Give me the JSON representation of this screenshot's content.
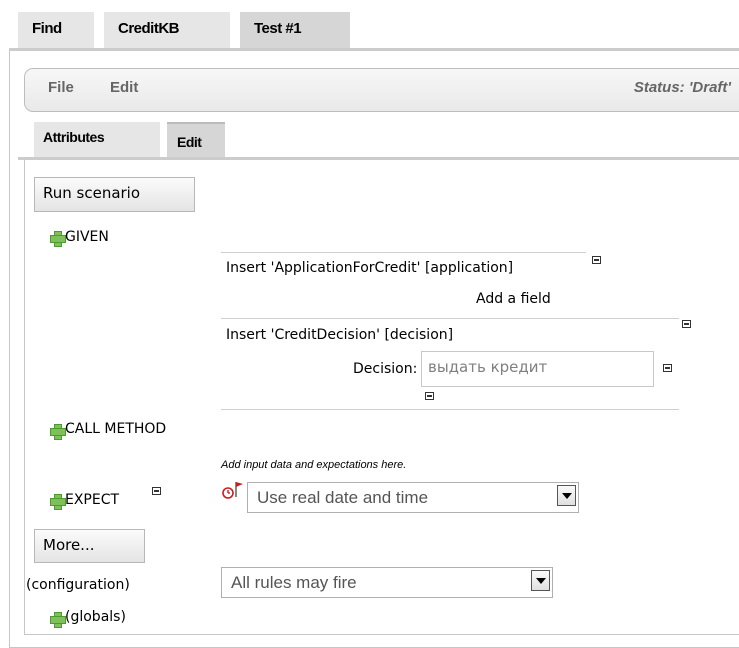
{
  "top_tabs": [
    "Find",
    "CreditKB",
    "Test #1"
  ],
  "menu": {
    "file": "File",
    "edit": "Edit",
    "status": "Status: 'Draft'"
  },
  "inner_tabs": [
    "Attributes",
    "Edit"
  ],
  "run_button": "Run scenario",
  "sections": {
    "given": "GIVEN",
    "call_method": "CALL METHOD",
    "expect": "EXPECT",
    "globals": "(globals)"
  },
  "facts": [
    {
      "label": "Insert 'ApplicationForCredit' [application]",
      "add_field": "Add a field"
    },
    {
      "label": "Insert 'CreditDecision' [decision]",
      "field_label": "Decision:",
      "field_value": "выдать кредит"
    }
  ],
  "hint": "Add input data and expectations here.",
  "date_select": {
    "value": "Use real date and time",
    "icon": "clock-flag-icon"
  },
  "more_button": "More...",
  "configuration": {
    "label": "(configuration)",
    "value": "All rules may fire"
  },
  "icons": {
    "add": "plus-icon",
    "remove": "minus-icon"
  },
  "colors": {
    "tab_bg": "#e6e6e6",
    "active_tab_bg": "#d6d6d6",
    "plus_green": "#7ec05a"
  }
}
